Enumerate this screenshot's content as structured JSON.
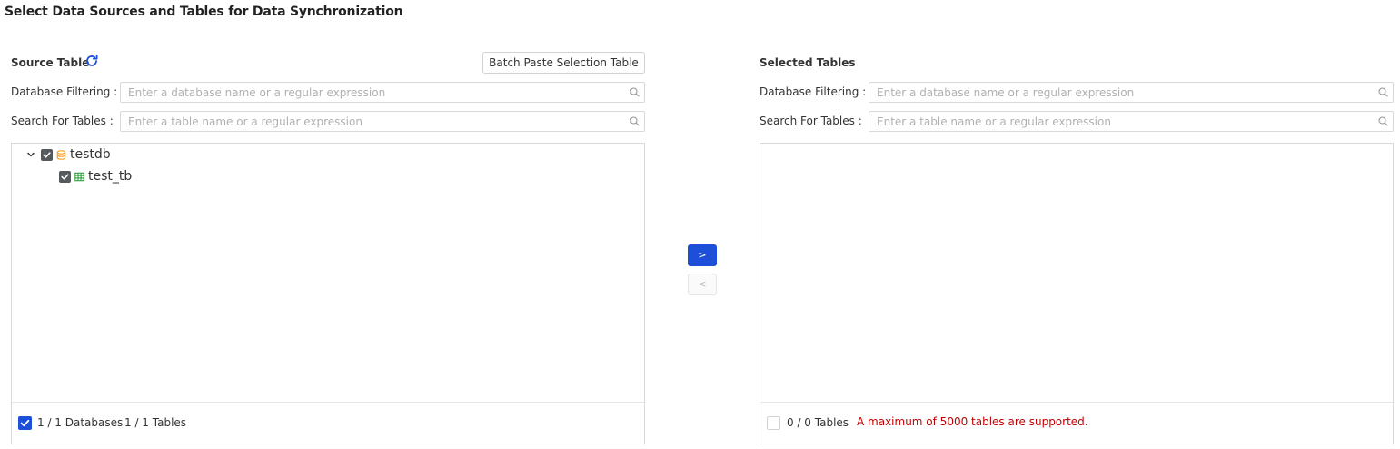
{
  "page": {
    "title": "Select Data Sources and Tables for Data Synchronization"
  },
  "source": {
    "title": "Source Table",
    "refresh_icon": "refresh-icon",
    "batch_button_label": "Batch Paste Selection Table",
    "db_filter": {
      "label": "Database Filtering :",
      "placeholder": "Enter a database name or a regular expression",
      "value": ""
    },
    "table_search": {
      "label": "Search For Tables :",
      "placeholder": "Enter a table name or a regular expression",
      "value": ""
    },
    "tree": [
      {
        "name": "testdb",
        "type": "database",
        "icon": "database-icon",
        "checked": true,
        "expanded": true,
        "children": [
          {
            "name": "test_tb",
            "type": "table",
            "icon": "table-icon",
            "checked": true
          }
        ]
      }
    ],
    "footer": {
      "select_all_checked": true,
      "databases_count": "1 / 1 Databases",
      "tables_count": "1 / 1 Tables"
    }
  },
  "transfer": {
    "move_right_label": ">",
    "move_left_label": "<",
    "move_left_disabled": true
  },
  "selected": {
    "title": "Selected Tables",
    "db_filter": {
      "label": "Database Filtering :",
      "placeholder": "Enter a database name or a regular expression",
      "value": ""
    },
    "table_search": {
      "label": "Search For Tables :",
      "placeholder": "Enter a table name or a regular expression",
      "value": ""
    },
    "footer": {
      "select_all_checked": false,
      "tables_count": "0 / 0 Tables",
      "limit_notice": "A maximum of 5000 tables are supported."
    }
  },
  "colors": {
    "primary": "#1d4fd8",
    "checkbox_dark": "#555a5f",
    "database_icon": "#f5a623",
    "table_icon": "#2e9e3f",
    "warning_text": "#c00000",
    "border": "#d9d9d9"
  }
}
